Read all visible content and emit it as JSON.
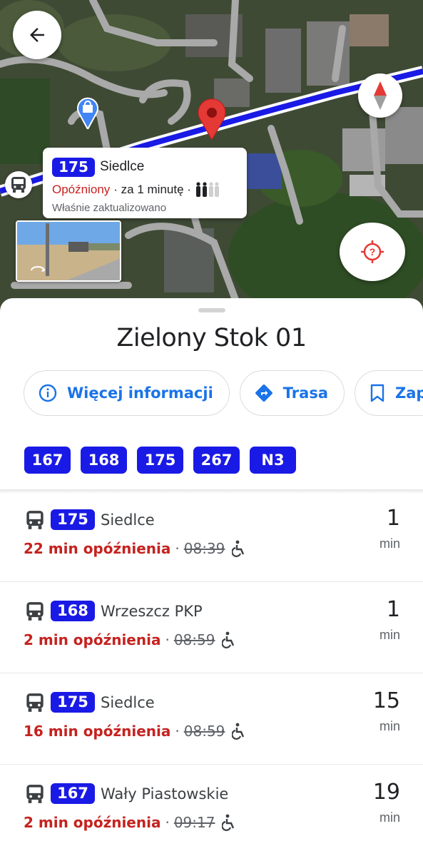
{
  "map": {
    "callout": {
      "line": "175",
      "destination": "Siedlce",
      "status": "Opóźniony",
      "arrival": "· za 1 minutę ·",
      "updated": "Właśnie zaktualizowano"
    },
    "icons": {
      "back": "arrow-back-icon",
      "compass": "compass-icon",
      "locate": "location-help-icon",
      "bus_stop": "bus-icon",
      "shop": "shopping-bag-pin-icon",
      "place_pin": "red-place-pin-icon"
    },
    "colors": {
      "route": "#1a1ae6",
      "pin": "#e53935"
    }
  },
  "sheet": {
    "title": "Zielony Stok 01",
    "actions": [
      {
        "label": "Więcej informacji",
        "icon": "info-icon"
      },
      {
        "label": "Trasa",
        "icon": "directions-icon"
      },
      {
        "label": "Zap",
        "icon": "bookmark-icon"
      }
    ],
    "lines": [
      "167",
      "168",
      "175",
      "267",
      "N3"
    ],
    "departures": [
      {
        "line": "175",
        "destination": "Siedlce",
        "delay": "22 min opóźnienia",
        "scheduled": "08:39",
        "eta": "1",
        "unit": "min"
      },
      {
        "line": "168",
        "destination": "Wrzeszcz PKP",
        "delay": "2 min opóźnienia",
        "scheduled": "08:59",
        "eta": "1",
        "unit": "min"
      },
      {
        "line": "175",
        "destination": "Siedlce",
        "delay": "16 min opóźnienia",
        "scheduled": "08:59",
        "eta": "15",
        "unit": "min"
      },
      {
        "line": "167",
        "destination": "Wały Piastowskie",
        "delay": "2 min opóźnienia",
        "scheduled": "09:17",
        "eta": "19",
        "unit": "min"
      }
    ],
    "colors": {
      "badge": "#1a1ae6",
      "delay": "#c5221f",
      "action": "#1a73e8"
    }
  }
}
